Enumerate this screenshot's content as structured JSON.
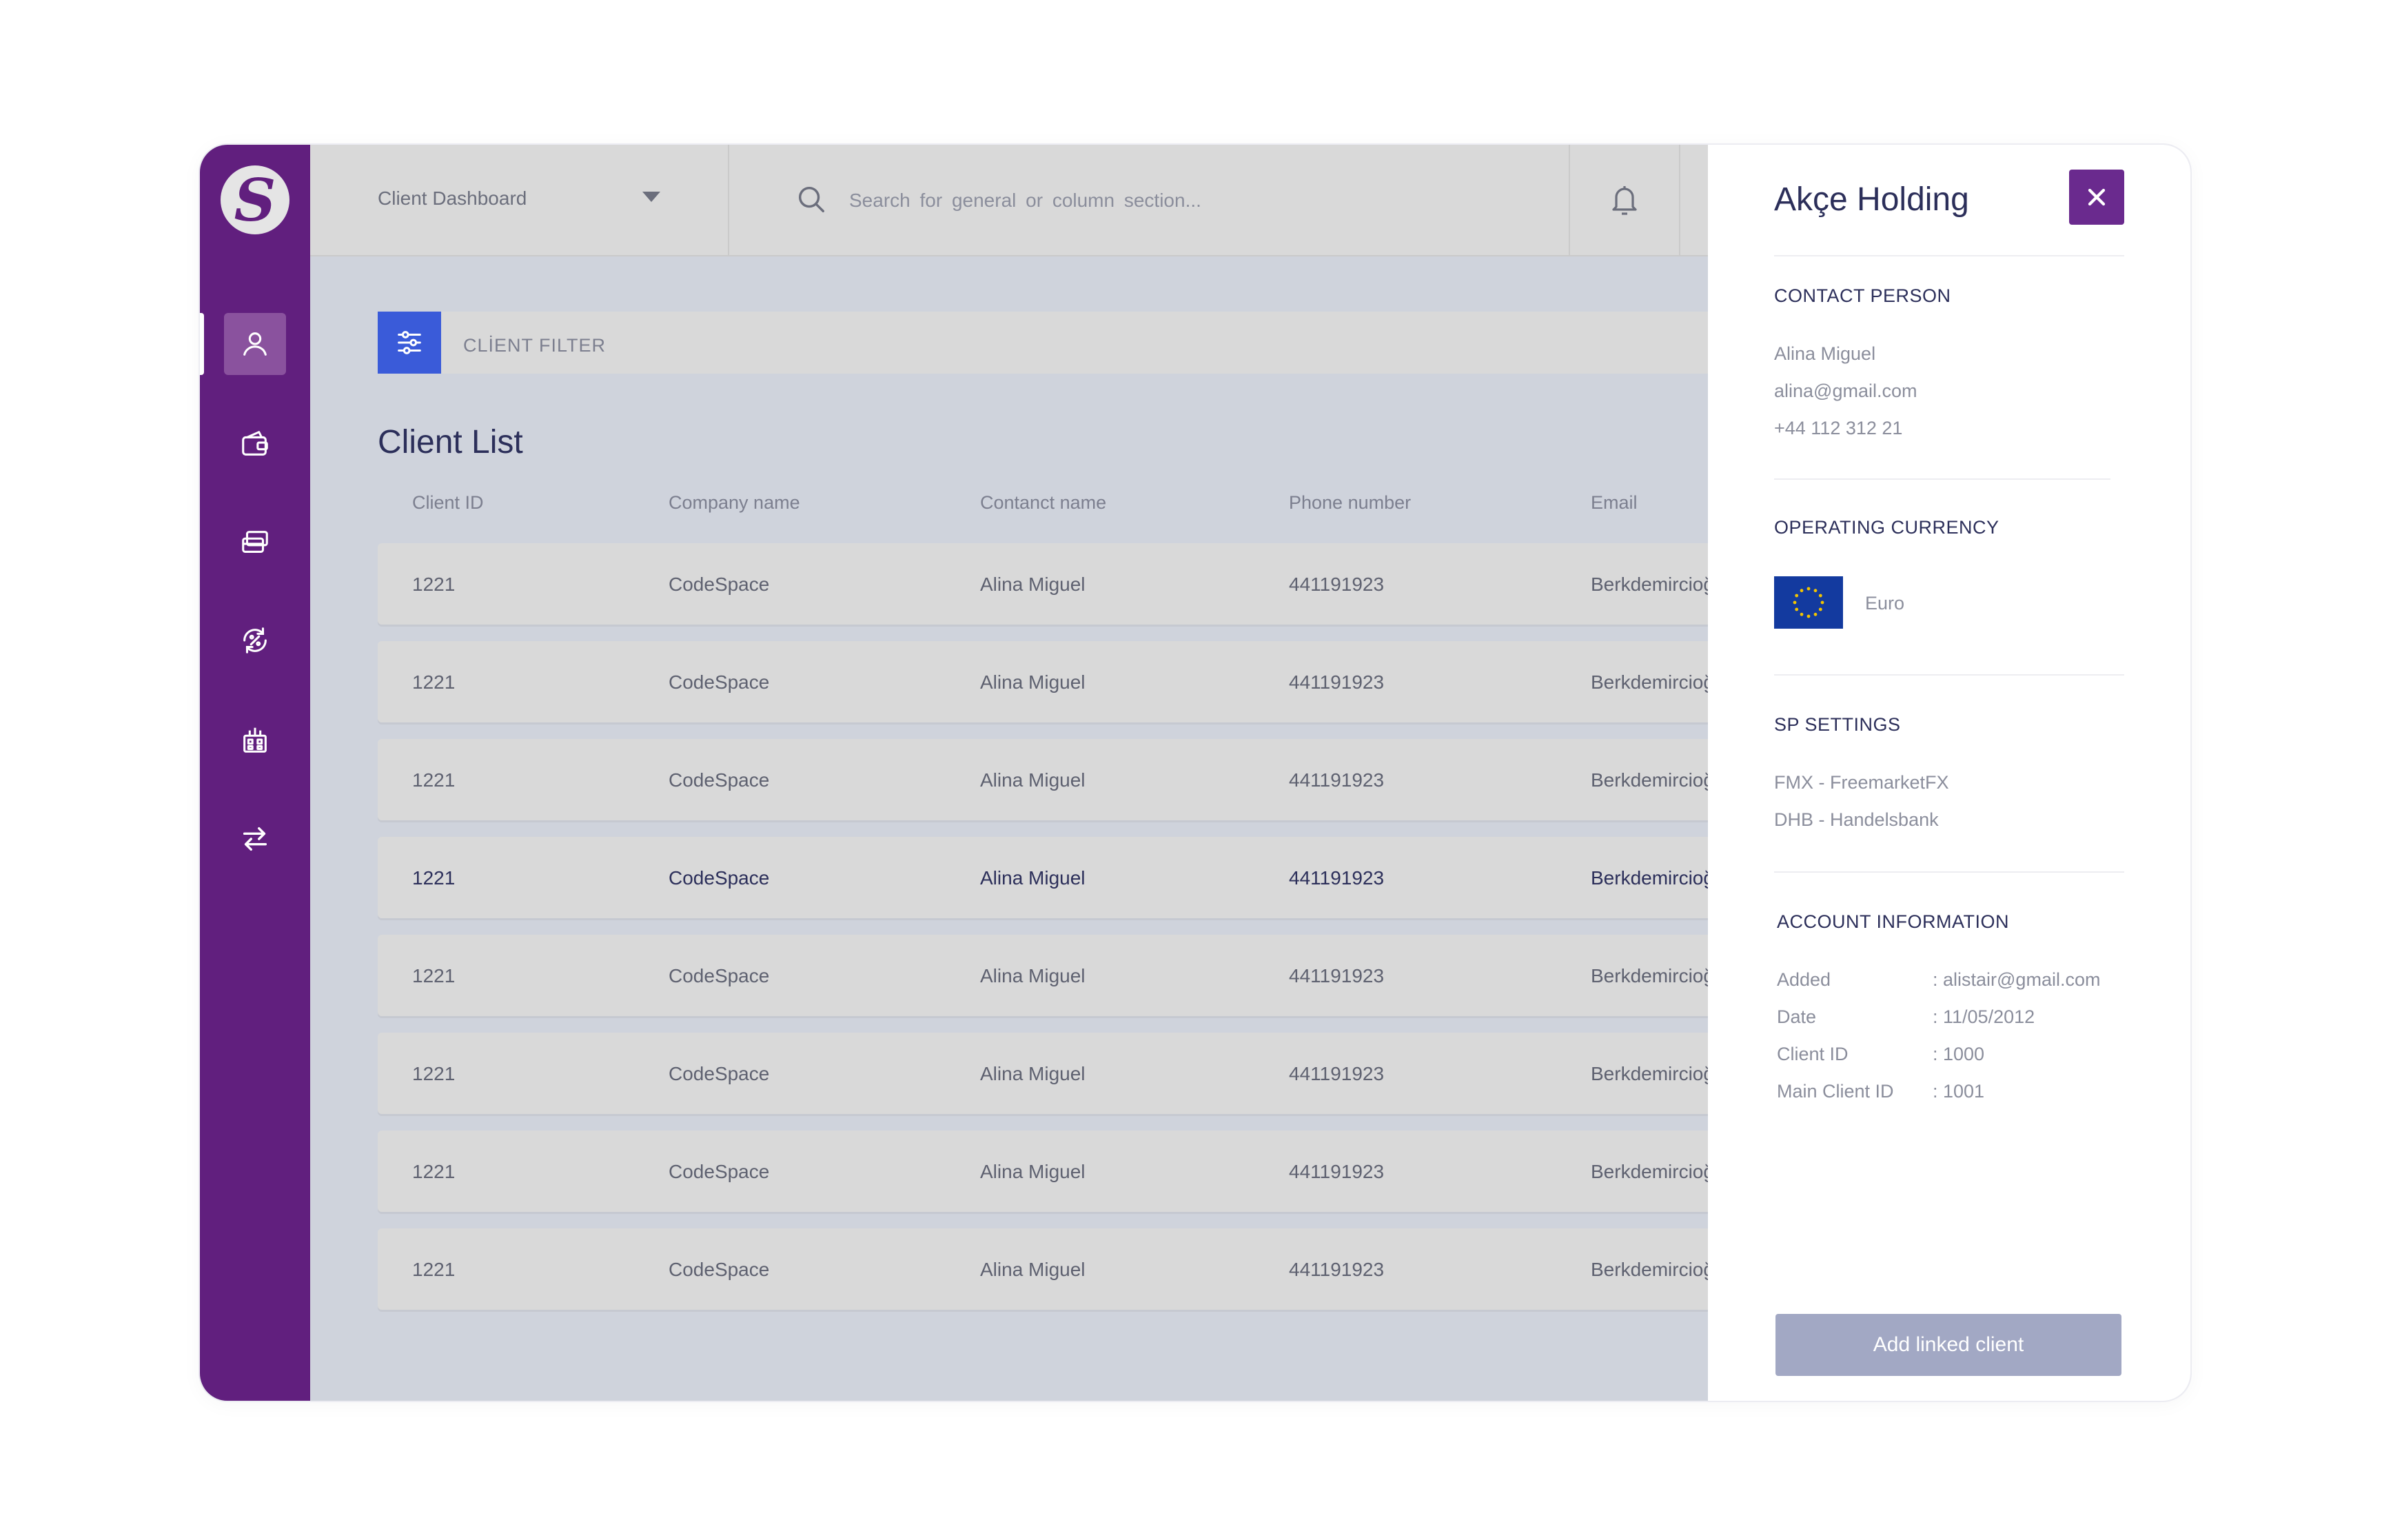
{
  "sidebar": {
    "logo_letter": "S",
    "items": [
      {
        "icon": "user-icon",
        "active": true
      },
      {
        "icon": "wallet-icon",
        "active": false
      },
      {
        "icon": "cards-icon",
        "active": false
      },
      {
        "icon": "percent-exchange-icon",
        "active": false
      },
      {
        "icon": "building-icon",
        "active": false
      },
      {
        "icon": "transfer-arrows-icon",
        "active": false
      }
    ]
  },
  "topbar": {
    "dashboard_label": "Client Dashboard",
    "search_placeholder": "Search for general or column section..."
  },
  "filter": {
    "label": "CLİENT FILTER"
  },
  "client_list": {
    "title": "Client List",
    "columns": [
      "Client ID",
      "Company name",
      "Contanct name",
      "Phone number",
      "Email"
    ],
    "rows": [
      {
        "id": "1221",
        "company": "CodeSpace",
        "contact": "Alina Miguel",
        "phone": "441191923",
        "email": "Berkdemircioğ"
      },
      {
        "id": "1221",
        "company": "CodeSpace",
        "contact": "Alina Miguel",
        "phone": "441191923",
        "email": "Berkdemircioğ"
      },
      {
        "id": "1221",
        "company": "CodeSpace",
        "contact": "Alina Miguel",
        "phone": "441191923",
        "email": "Berkdemircioğ"
      },
      {
        "id": "1221",
        "company": "CodeSpace",
        "contact": "Alina Miguel",
        "phone": "441191923",
        "email": "Berkdemircioğ"
      },
      {
        "id": "1221",
        "company": "CodeSpace",
        "contact": "Alina Miguel",
        "phone": "441191923",
        "email": "Berkdemircioğ"
      },
      {
        "id": "1221",
        "company": "CodeSpace",
        "contact": "Alina Miguel",
        "phone": "441191923",
        "email": "Berkdemircioğ"
      },
      {
        "id": "1221",
        "company": "CodeSpace",
        "contact": "Alina Miguel",
        "phone": "441191923",
        "email": "Berkdemircioğ"
      },
      {
        "id": "1221",
        "company": "CodeSpace",
        "contact": "Alina Miguel",
        "phone": "441191923",
        "email": "Berkdemircioğ"
      }
    ]
  },
  "panel": {
    "title": "Akçe Holding",
    "contact": {
      "heading": "CONTACT PERSON",
      "name": "Alina Miguel",
      "email": "alina@gmail.com",
      "phone": "+44 112 312 21"
    },
    "currency": {
      "heading": "OPERATING CURRENCY",
      "name": "Euro"
    },
    "sp_settings": {
      "heading": "SP SETTINGS",
      "items": [
        "FMX - FreemarketFX",
        "DHB - Handelsbank"
      ]
    },
    "account": {
      "heading": "ACCOUNT INFORMATION",
      "rows": [
        {
          "label": "Added",
          "value": ": alistair@gmail.com"
        },
        {
          "label": "Date",
          "value": ": 11/05/2012"
        },
        {
          "label": "Client ID",
          "value": ": 1000"
        },
        {
          "label": "Main Client ID",
          "value": ": 1001"
        }
      ]
    },
    "add_button": "Add linked client"
  },
  "colors": {
    "sidebar": "#611f7e",
    "accent_blue": "#3a5bd9",
    "close_button": "#6a2a8e",
    "add_button": "#a2a8c4",
    "title_text": "#2c2f5a"
  }
}
